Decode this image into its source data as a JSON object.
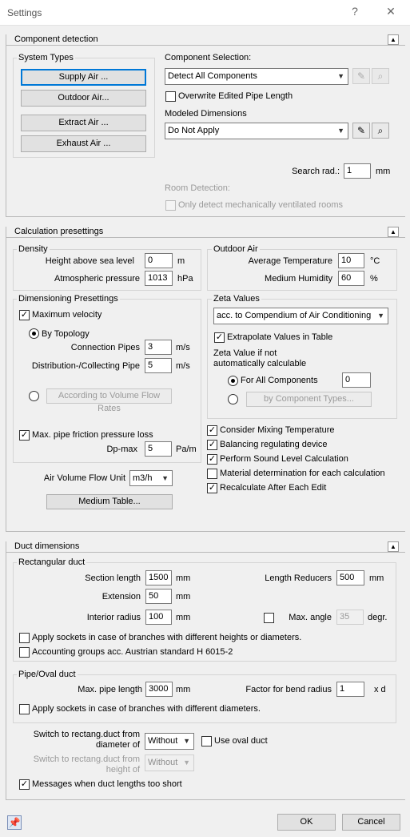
{
  "window": {
    "title": "Settings",
    "help": "?",
    "close": "✕"
  },
  "component_detection": {
    "title": "Component detection",
    "system_types_title": "System Types",
    "btn_supply": "Supply Air ...",
    "btn_outdoor": "Outdoor Air...",
    "btn_extract": "Extract Air ...",
    "btn_exhaust": "Exhaust Air ...",
    "component_selection_label": "Component Selection:",
    "component_selection_value": "Detect All Components",
    "overwrite_label": "Overwrite Edited Pipe Length",
    "modeled_dimensions_label": "Modeled Dimensions",
    "modeled_dimensions_value": "Do Not Apply",
    "search_rad_label": "Search rad.:",
    "search_rad_value": "1",
    "search_rad_unit": "mm",
    "room_detection_label": "Room Detection:",
    "only_detect_label": "Only detect mechanically ventilated rooms"
  },
  "calc": {
    "title": "Calculation presettings",
    "density_title": "Density",
    "height_label": "Height above sea level",
    "height_value": "0",
    "height_unit": "m",
    "pressure_label": "Atmospheric pressure",
    "pressure_value": "1013",
    "pressure_unit": "hPa",
    "outdoor_title": "Outdoor Air",
    "avg_temp_label": "Average Temperature",
    "avg_temp_value": "10",
    "avg_temp_unit": "°C",
    "humidity_label": "Medium Humidity",
    "humidity_value": "60",
    "humidity_unit": "%",
    "dim_title": "Dimensioning Presettings",
    "max_velocity_label": "Maximum velocity",
    "by_topology_label": "By Topology",
    "conn_pipes_label": "Connection Pipes",
    "conn_pipes_value": "3",
    "conn_pipes_unit": "m/s",
    "dist_pipe_label": "Distribution-/Collecting Pipe",
    "dist_pipe_value": "5",
    "dist_pipe_unit": "m/s",
    "volume_flow_btn": "According to Volume Flow Rates",
    "max_friction_label": "Max. pipe friction pressure loss",
    "dpmax_label": "Dp-max",
    "dpmax_value": "5",
    "dpmax_unit": "Pa/m",
    "zeta_title": "Zeta Values",
    "zeta_select": "acc. to Compendium of Air Conditioning",
    "extrapolate_label": "Extrapolate Values in Table",
    "zeta_if_not_1": "Zeta Value if not",
    "zeta_if_not_2": "automatically calculable",
    "for_all_label": "For All Components",
    "for_all_value": "0",
    "by_component_btn": "by Component Types...",
    "consider_mixing": "Consider Mixing Temperature",
    "balancing": "Balancing regulating device",
    "sound_level": "Perform Sound Level Calculation",
    "material": "Material determination for each calculation",
    "recalculate": "Recalculate After Each Edit",
    "air_volume_label": "Air Volume Flow Unit",
    "air_volume_value": "m3/h",
    "medium_table_btn": "Medium Table..."
  },
  "duct": {
    "title": "Duct dimensions",
    "rect_title": "Rectangular duct",
    "section_length_label": "Section length",
    "section_length_value": "1500",
    "section_length_unit": "mm",
    "length_reducers_label": "Length Reducers",
    "length_reducers_value": "500",
    "length_reducers_unit": "mm",
    "extension_label": "Extension",
    "extension_value": "50",
    "extension_unit": "mm",
    "interior_radius_label": "Interior radius",
    "interior_radius_value": "100",
    "interior_radius_unit": "mm",
    "max_angle_label": "Max. angle",
    "max_angle_value": "35",
    "max_angle_unit": "degr.",
    "sockets_rect_label": "Apply sockets in case of branches with different heights or diameters.",
    "accounting_label": "Accounting groups acc. Austrian standard H 6015-2",
    "pipe_title": "Pipe/Oval duct",
    "max_pipe_label": "Max. pipe length",
    "max_pipe_value": "3000",
    "max_pipe_unit": "mm",
    "bend_factor_label": "Factor for bend radius",
    "bend_factor_value": "1",
    "bend_factor_unit": "x d",
    "sockets_pipe_label": "Apply sockets in case of branches with different diameters.",
    "switch_diam_label_1": "Switch to rectang.duct from",
    "switch_diam_label_2": "diameter of",
    "switch_diam_value": "Without",
    "use_oval_label": "Use oval duct",
    "switch_height_label_1": "Switch to rectang.duct from",
    "switch_height_label_2": "height of",
    "switch_height_value": "Without",
    "messages_label": "Messages when duct lengths too short"
  },
  "footer": {
    "ok": "OK",
    "cancel": "Cancel"
  }
}
